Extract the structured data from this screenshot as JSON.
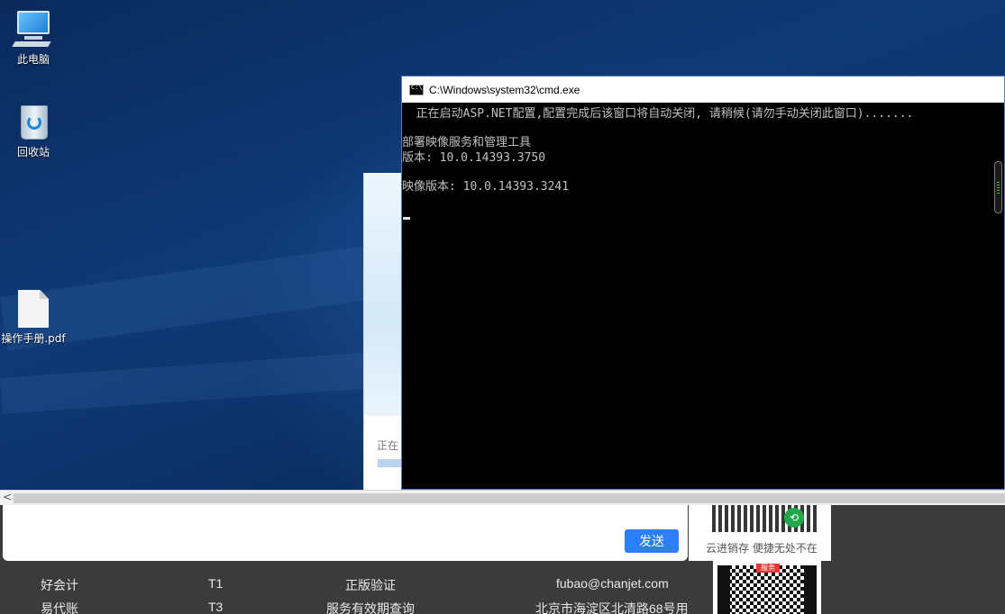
{
  "desktop": {
    "icons": [
      {
        "label": "此电脑",
        "icon": "computer-icon"
      },
      {
        "label": "回收站",
        "icon": "recycle-bin-icon"
      },
      {
        "label": "操作手册.pdf",
        "icon": "pdf-file-icon"
      }
    ]
  },
  "installer": {
    "loading_text": "正在"
  },
  "cmd": {
    "title": "C:\\Windows\\system32\\cmd.exe",
    "lines": [
      "  正在启动ASP.NET配置,配置完成后该窗口将自动关闭, 请稍候(请勿手动关闭此窗口).......",
      "",
      "部署映像服务和管理工具",
      "版本: 10.0.14393.3750",
      "",
      "映像版本: 10.0.14393.3241"
    ]
  },
  "browser": {
    "scroll_left_arrow": "<",
    "send_label": "发送",
    "qr_caption": "云进销存 便捷无处不在",
    "qr_tag": "服务",
    "footer": {
      "col1": [
        "好会计",
        "易代账"
      ],
      "col2": [
        "T1",
        "T3"
      ],
      "col3": [
        "正版验证",
        "服务有效期查询"
      ],
      "col4": [
        "fubao@chanjet.com",
        "北京市海淀区北清路68号用"
      ]
    }
  }
}
